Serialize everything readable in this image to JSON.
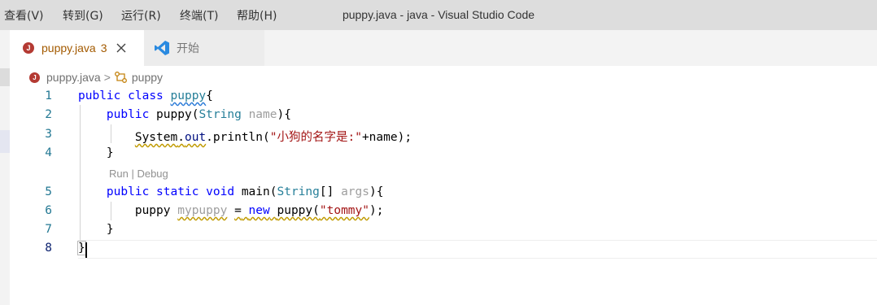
{
  "menu": [
    {
      "label": "查看(V)"
    },
    {
      "label": "转到(G)"
    },
    {
      "label": "运行(R)"
    },
    {
      "label": "终端(T)"
    },
    {
      "label": "帮助(H)"
    }
  ],
  "window_title": "puppy.java - java - Visual Studio Code",
  "tabs": {
    "active": {
      "filename": "puppy.java",
      "problems": "3",
      "icon": "java-file-icon"
    },
    "welcome": {
      "label": "开始",
      "icon": "vscode-icon"
    }
  },
  "breadcrumb": {
    "file": "puppy.java",
    "symbol": "puppy",
    "separator": ">"
  },
  "code_lens": "Run | Debug",
  "line_numbers": [
    "1",
    "2",
    "3",
    "4",
    "5",
    "6",
    "7",
    "8"
  ],
  "code": {
    "l1": {
      "kw1": "public",
      "kw2": "class",
      "name": "puppy",
      "brace": "{"
    },
    "l2": {
      "kw": "public",
      "name": "puppy(",
      "type": "String",
      "param": "name",
      "close": "){"
    },
    "l3": {
      "obj": "System",
      "dot1": ".",
      "out": "out",
      "rest": ".println(",
      "str": "\"小狗的名字是:\"",
      "tail": "+name);"
    },
    "l4": {
      "text": "}"
    },
    "l5": {
      "kw1": "public",
      "kw2": "static",
      "kw3": "void",
      "name": "main(",
      "type": "String",
      "arr": "[]",
      "param": "args",
      "close": "){"
    },
    "l6": {
      "type": "puppy",
      "var": "mypuppy",
      "eq": "=",
      "kw": "new",
      "ctor": "puppy(",
      "str": "\"tommy\"",
      "tail": ");"
    },
    "l7": {
      "text": "}"
    },
    "l8": {
      "text": "}"
    }
  },
  "colors": {
    "keyword": "#0000ff",
    "string": "#a31515",
    "type": "#267f99",
    "java_badge": "#b43a33",
    "vscode_blue": "#2a8ae0"
  }
}
